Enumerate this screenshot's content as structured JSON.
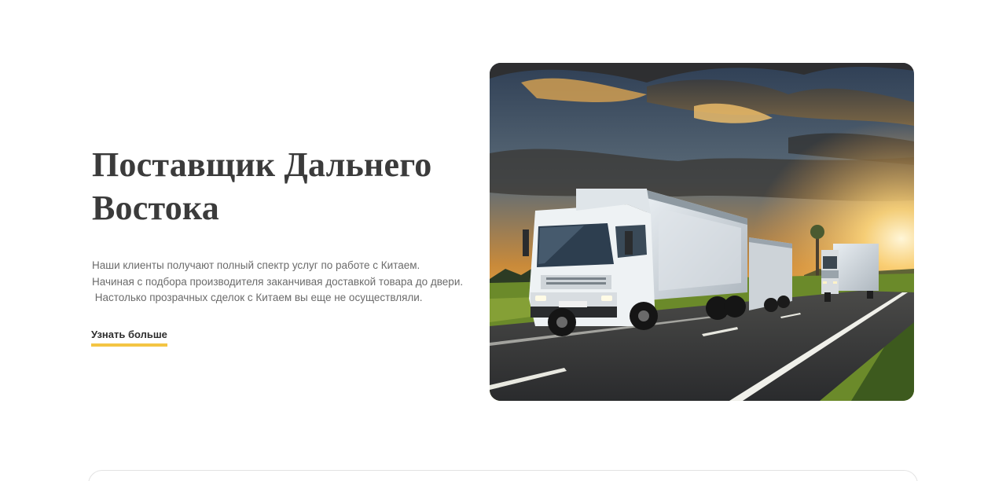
{
  "hero": {
    "title": "Поставщик Дальнего Востока",
    "description_lines": [
      "Наши клиенты получают полный спектр услуг по работе с Китаем.",
      "Начиная с подбора производителя заканчивая доставкой товара до двери.",
      " Настолько прозрачных сделок с Китаем вы еще не осуществляли."
    ],
    "cta_label": "Узнать больше",
    "image_subject": "trucks-on-highway-at-sunset"
  },
  "colors": {
    "accent": "#f4c543",
    "title": "#3b3b3b",
    "text": "#6b6b6b"
  }
}
